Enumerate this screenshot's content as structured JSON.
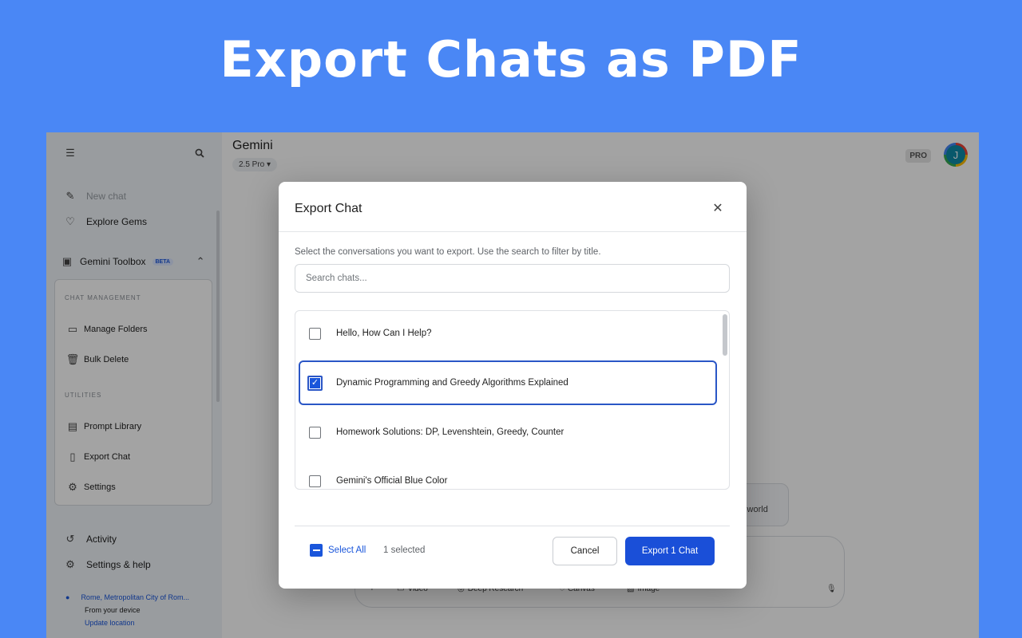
{
  "hero": {
    "title": "Export Chats as PDF"
  },
  "sidebar": {
    "new_chat": "New chat",
    "explore_gems": "Explore Gems",
    "toolbox": {
      "label": "Gemini Toolbox",
      "badge": "BETA"
    },
    "sections": {
      "chat_management": "CHAT MANAGEMENT",
      "utilities": "UTILITIES"
    },
    "items": {
      "manage_folders": "Manage Folders",
      "bulk_delete": "Bulk Delete",
      "prompt_library": "Prompt Library",
      "export_chat": "Export Chat",
      "settings": "Settings"
    },
    "activity": "Activity",
    "settings_help": "Settings & help",
    "location": {
      "place": "Rome, Metropolitan City of Rom...",
      "source": "From your device",
      "update": "Update location"
    }
  },
  "main": {
    "title": "Gemini",
    "model": "2.5 Pro",
    "pro_badge": "PRO",
    "avatar_initial": "J",
    "suggestion": "c world",
    "tools": {
      "video": "Video",
      "deep_research": "Deep Research",
      "canvas": "Canvas",
      "image": "Image"
    }
  },
  "modal": {
    "title": "Export Chat",
    "description": "Select the conversations you want to export. Use the search to filter by title.",
    "search_placeholder": "Search chats...",
    "chats": [
      {
        "title": "Hello, How Can I Help?",
        "selected": false
      },
      {
        "title": "Dynamic Programming and Greedy Algorithms Explained",
        "selected": true
      },
      {
        "title": "Homework Solutions: DP, Levenshtein, Greedy, Counter",
        "selected": false
      },
      {
        "title": "Gemini's Official Blue Color",
        "selected": false
      }
    ],
    "select_all": "Select All",
    "selected_count": "1 selected",
    "cancel": "Cancel",
    "export": "Export 1 Chat"
  },
  "colors": {
    "background": "#4a87f5",
    "accent": "#1a56db",
    "selected_border": "#2a56c6"
  }
}
